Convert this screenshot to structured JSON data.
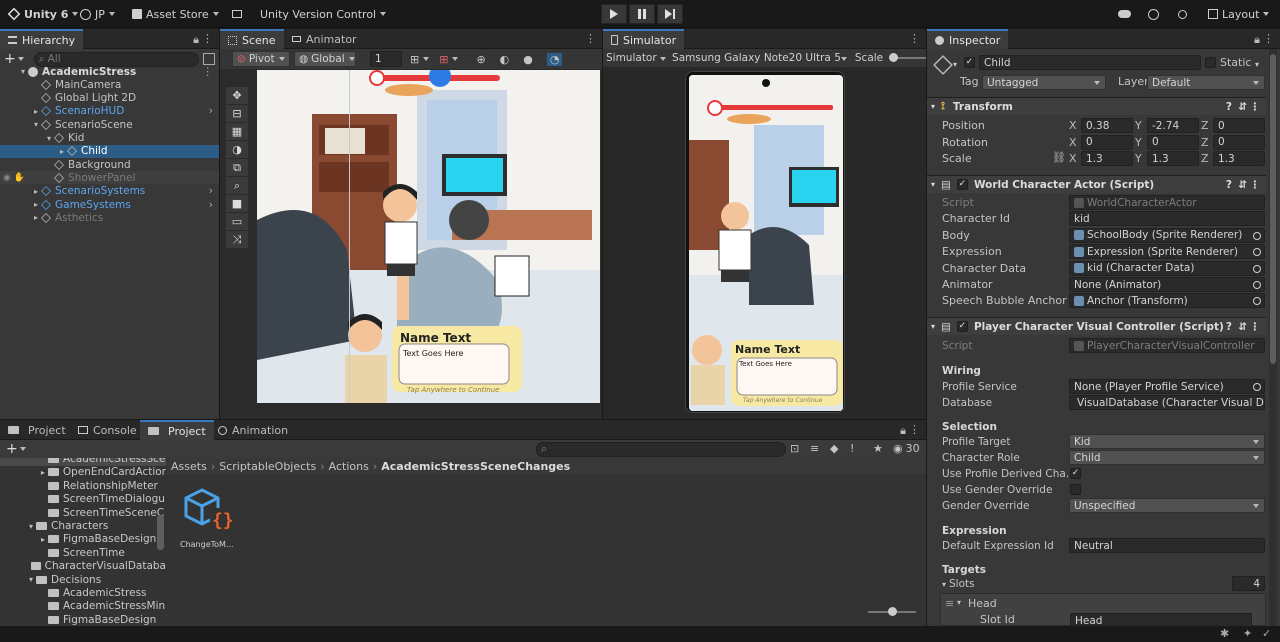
{
  "toolbar": {
    "app": "Unity 6",
    "account": "JP",
    "asset_store": "Asset Store",
    "version_control": "Unity Version Control",
    "layout": "Layout"
  },
  "hierarchy": {
    "tab": "Hierarchy",
    "search_placeholder": "All",
    "items": [
      {
        "label": "AcademicStress",
        "depth": 0,
        "bold": true,
        "color": "#d8d8d8"
      },
      {
        "label": "MainCamera",
        "depth": 1,
        "color": "#c4c4c4"
      },
      {
        "label": "Global Light 2D",
        "depth": 1,
        "color": "#c4c4c4"
      },
      {
        "label": "ScenarioHUD",
        "depth": 1,
        "color": "#5ca5f0"
      },
      {
        "label": "ScenarioScene",
        "depth": 1,
        "color": "#c4c4c4"
      },
      {
        "label": "Kid",
        "depth": 2,
        "color": "#c4c4c4"
      },
      {
        "label": "Child",
        "depth": 3,
        "color": "#ffffff",
        "selected": true
      },
      {
        "label": "Background",
        "depth": 2,
        "color": "#c4c4c4"
      },
      {
        "label": "ShowerPanel",
        "depth": 2,
        "color": "#7a7a7a"
      },
      {
        "label": "ScenarioSystems",
        "depth": 1,
        "color": "#5ca5f0"
      },
      {
        "label": "GameSystems",
        "depth": 1,
        "color": "#5ca5f0"
      },
      {
        "label": "Asthetics",
        "depth": 1,
        "color": "#7a7a7a"
      }
    ]
  },
  "scene": {
    "tab_scene": "Scene",
    "tab_animator": "Animator",
    "pivot": "Pivot",
    "global": "Global",
    "grid_value": "1",
    "name_text": "Name Text",
    "text_goes_here": "Text Goes Here",
    "tap_hint": "Tap Anywhere to Continue"
  },
  "simulator": {
    "tab": "Simulator",
    "mode": "Simulator",
    "device": "Samsung Galaxy Note20 Ultra 5",
    "scale": "Scale"
  },
  "bottom": {
    "tabs": [
      "Project",
      "Console",
      "Project",
      "Animation"
    ],
    "count": "30",
    "breadcrumb": [
      "Assets",
      "ScriptableObjects",
      "Actions",
      "AcademicStressSceneChanges"
    ],
    "tree": [
      {
        "label": "AcademicStressSce",
        "depth": 2,
        "selected": true
      },
      {
        "label": "OpenEndCardActior",
        "depth": 2
      },
      {
        "label": "RelationshipMeter",
        "depth": 2
      },
      {
        "label": "ScreenTimeDialogu",
        "depth": 2
      },
      {
        "label": "ScreenTimeSceneC",
        "depth": 2
      },
      {
        "label": "Characters",
        "depth": 1
      },
      {
        "label": "FigmaBaseDesign",
        "depth": 2
      },
      {
        "label": "ScreenTime",
        "depth": 2
      },
      {
        "label": "CharacterVisualDataba",
        "depth": 1
      },
      {
        "label": "Decisions",
        "depth": 1
      },
      {
        "label": "AcademicStress",
        "depth": 2
      },
      {
        "label": "AcademicStressMin",
        "depth": 2
      },
      {
        "label": "FigmaBaseDesign",
        "depth": 2
      }
    ],
    "asset": "ChangeToM..."
  },
  "inspector": {
    "tab": "Inspector",
    "object_name": "Child",
    "static": "Static",
    "tag_label": "Tag",
    "tag": "Untagged",
    "layer_label": "Layer",
    "layer": "Default",
    "transform": {
      "title": "Transform",
      "position_label": "Position",
      "rotation_label": "Rotation",
      "scale_label": "Scale",
      "position": [
        "0.38",
        "-2.74",
        "0"
      ],
      "rotation": [
        "0",
        "0",
        "0"
      ],
      "scale": [
        "1.3",
        "1.3",
        "1.3"
      ]
    },
    "wca": {
      "title": "World Character Actor (Script)",
      "rows": [
        {
          "label": "Script",
          "value": "WorldCharacterActor",
          "dim": true
        },
        {
          "label": "Character Id",
          "value": "kid"
        },
        {
          "label": "Body",
          "value": "SchoolBody (Sprite Renderer)",
          "ref": true
        },
        {
          "label": "Expression",
          "value": "Expression (Sprite Renderer)",
          "ref": true
        },
        {
          "label": "Character Data",
          "value": "kid (Character Data)",
          "ref": true
        },
        {
          "label": "Animator",
          "value": "None (Animator)",
          "ref": true
        },
        {
          "label": "Speech Bubble Anchor",
          "value": "Anchor (Transform)",
          "ref": true
        }
      ]
    },
    "pcvc": {
      "title": "Player Character Visual Controller (Script)",
      "script_label": "Script",
      "script": "PlayerCharacterVisualController",
      "wiring": "Wiring",
      "profile_service_label": "Profile Service",
      "profile_service": "None (Player Profile Service)",
      "database_label": "Database",
      "database": "VisualDatabase (Character Visual D",
      "selection": "Selection",
      "profile_target_label": "Profile Target",
      "profile_target": "Kid",
      "character_role_label": "Character Role",
      "character_role": "Child",
      "use_profile_label": "Use Profile Derived Cha...",
      "use_gender_label": "Use Gender Override",
      "gender_override_label": "Gender Override",
      "gender_override": "Unspecified",
      "expression": "Expression",
      "default_expr_label": "Default Expression Id",
      "default_expr": "Neutral",
      "targets": "Targets",
      "slots_label": "Slots",
      "slots_count": "4",
      "head": "Head",
      "slot_id_label": "Slot Id",
      "slot_id": "Head"
    }
  }
}
